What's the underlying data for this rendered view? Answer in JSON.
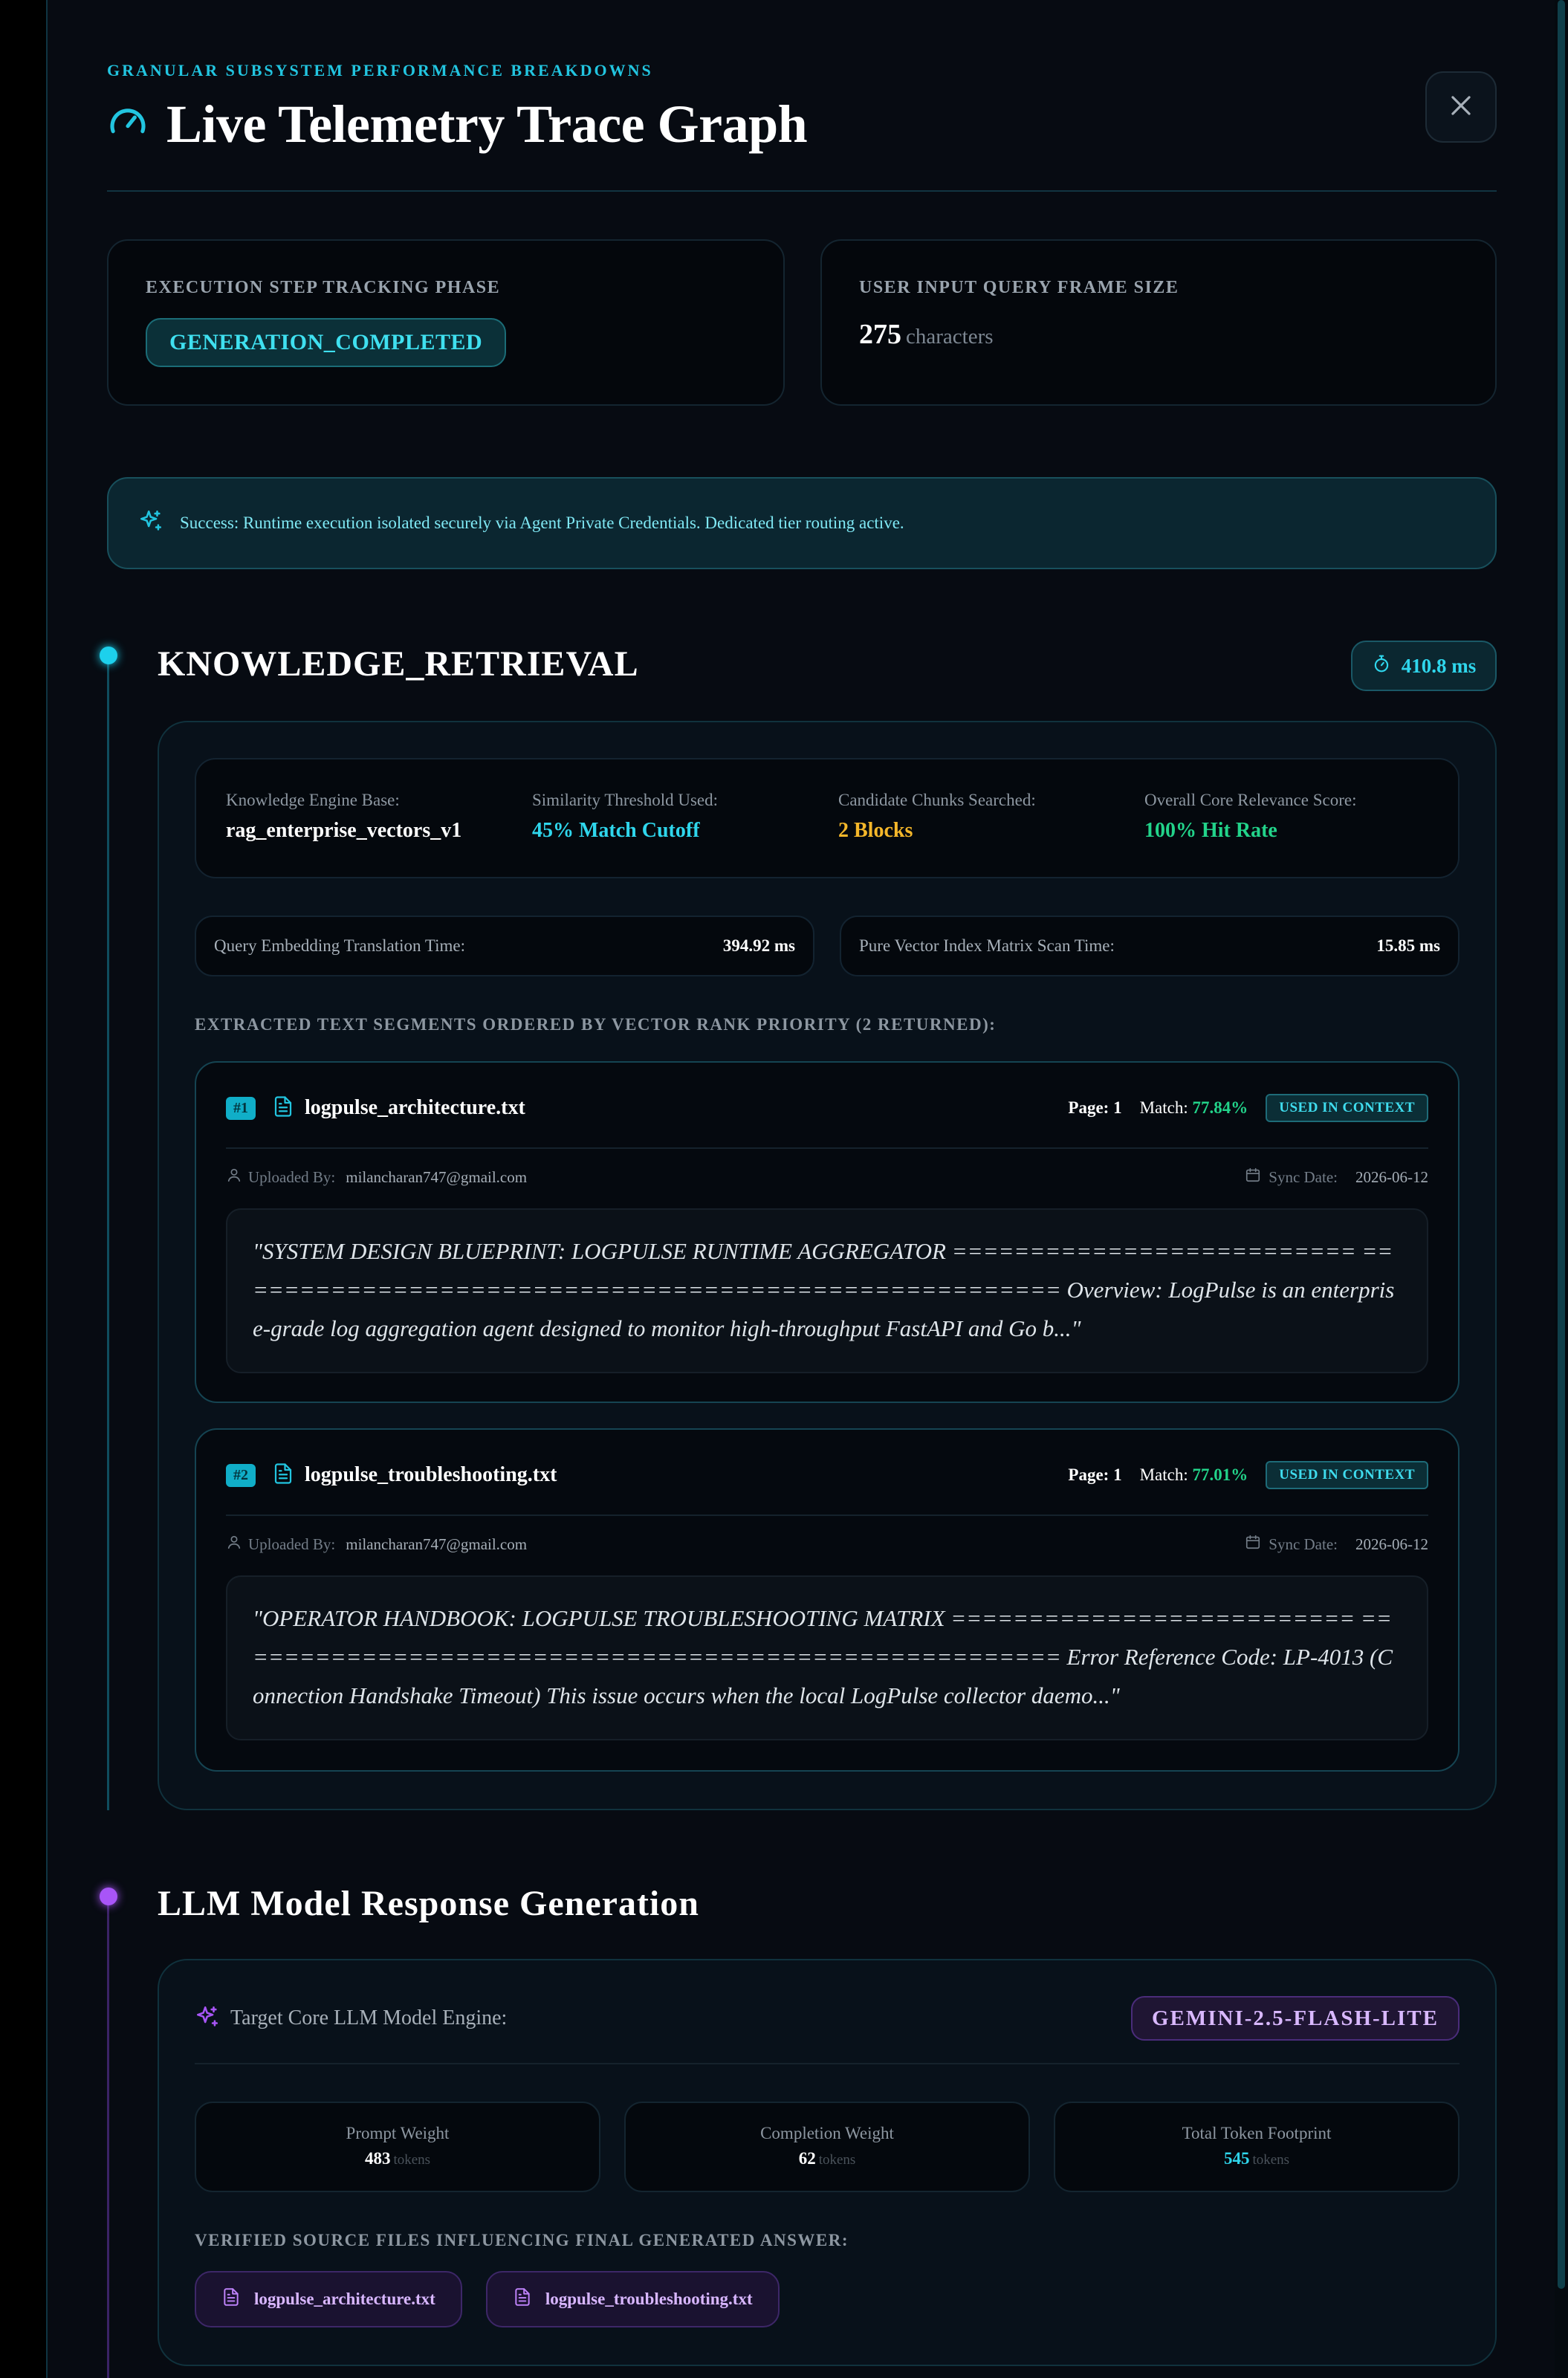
{
  "header": {
    "eyebrow": "GRANULAR SUBSYSTEM PERFORMANCE BREAKDOWNS",
    "title": "Live Telemetry Trace Graph"
  },
  "stats": {
    "phase_label": "EXECUTION STEP TRACKING PHASE",
    "phase_value": "GENERATION_COMPLETED",
    "query_label": "USER INPUT QUERY FRAME SIZE",
    "query_value": "275",
    "query_unit": "characters"
  },
  "banner": {
    "text": "Success: Runtime execution isolated securely via Agent Private Credentials. Dedicated tier routing active."
  },
  "retrieval": {
    "title": "KNOWLEDGE_RETRIEVAL",
    "duration": "410.8 ms",
    "metrics": [
      {
        "label": "Knowledge Engine Base:",
        "value": "rag_enterprise_vectors_v1",
        "color": "#ffffff"
      },
      {
        "label": "Similarity Threshold Used:",
        "value": "45% Match Cutoff",
        "color": "#2fd6ec"
      },
      {
        "label": "Candidate Chunks Searched:",
        "value": "2 Blocks",
        "color": "#f5b72a"
      },
      {
        "label": "Overall Core Relevance Score:",
        "value": "100% Hit Rate",
        "color": "#22d38a"
      }
    ],
    "embedding_label": "Query Embedding Translation Time:",
    "embedding_value": "394.92 ms",
    "scan_label": "Pure Vector Index Matrix Scan Time:",
    "scan_value": "15.85 ms",
    "segments_heading": "EXTRACTED TEXT SEGMENTS ORDERED BY VECTOR RANK PRIORITY (2 RETURNED):",
    "chunks": [
      {
        "rank": "#1",
        "file": "logpulse_architecture.txt",
        "page_label": "Page:",
        "page": "1",
        "match_label": "Match:",
        "match": "77.84%",
        "status": "USED IN CONTEXT",
        "uploaded_label": "Uploaded By:",
        "uploaded_by": "milancharan747@gmail.com",
        "sync_label": "Sync Date:",
        "sync_date": "2026-06-12",
        "excerpt": "\"SYSTEM DESIGN BLUEPRINT: LOGPULSE RUNTIME AGGREGATOR ========================== ====================================================== Overview: LogPulse is an enterprise-grade log aggregation agent designed to monitor high-throughput FastAPI and Go b...\""
      },
      {
        "rank": "#2",
        "file": "logpulse_troubleshooting.txt",
        "page_label": "Page:",
        "page": "1",
        "match_label": "Match:",
        "match": "77.01%",
        "status": "USED IN CONTEXT",
        "uploaded_label": "Uploaded By:",
        "uploaded_by": "milancharan747@gmail.com",
        "sync_label": "Sync Date:",
        "sync_date": "2026-06-12",
        "excerpt": "\"OPERATOR HANDBOOK: LOGPULSE TROUBLESHOOTING MATRIX ========================== ====================================================== Error Reference Code: LP-4013 (Connection Handshake Timeout) This issue occurs when the local LogPulse collector daemo...\""
      }
    ]
  },
  "generation": {
    "title": "LLM Model Response Generation",
    "engine_label": "Target Core LLM Model Engine:",
    "model": "GEMINI-2.5-FLASH-LITE",
    "tokens": [
      {
        "label": "Prompt Weight",
        "value": "483",
        "unit": "tokens",
        "color": "#ffffff"
      },
      {
        "label": "Completion Weight",
        "value": "62",
        "unit": "tokens",
        "color": "#ffffff"
      },
      {
        "label": "Total Token Footprint",
        "value": "545",
        "unit": "tokens",
        "color": "#2fd6ec"
      }
    ],
    "sources_heading": "VERIFIED SOURCE FILES INFLUENCING FINAL GENERATED ANSWER:",
    "sources": [
      "logpulse_architecture.txt",
      "logpulse_troubleshooting.txt"
    ]
  },
  "colors": {
    "accent": "#22c5e0",
    "success": "#22d38a",
    "warning": "#f5b72a",
    "purple": "#a855f7"
  },
  "icons": {
    "title": "gauge-icon",
    "close": "close-icon",
    "banner": "sparkles-icon",
    "duration": "stopwatch-icon",
    "file": "file-text-icon",
    "user": "user-icon",
    "calendar": "calendar-icon"
  }
}
